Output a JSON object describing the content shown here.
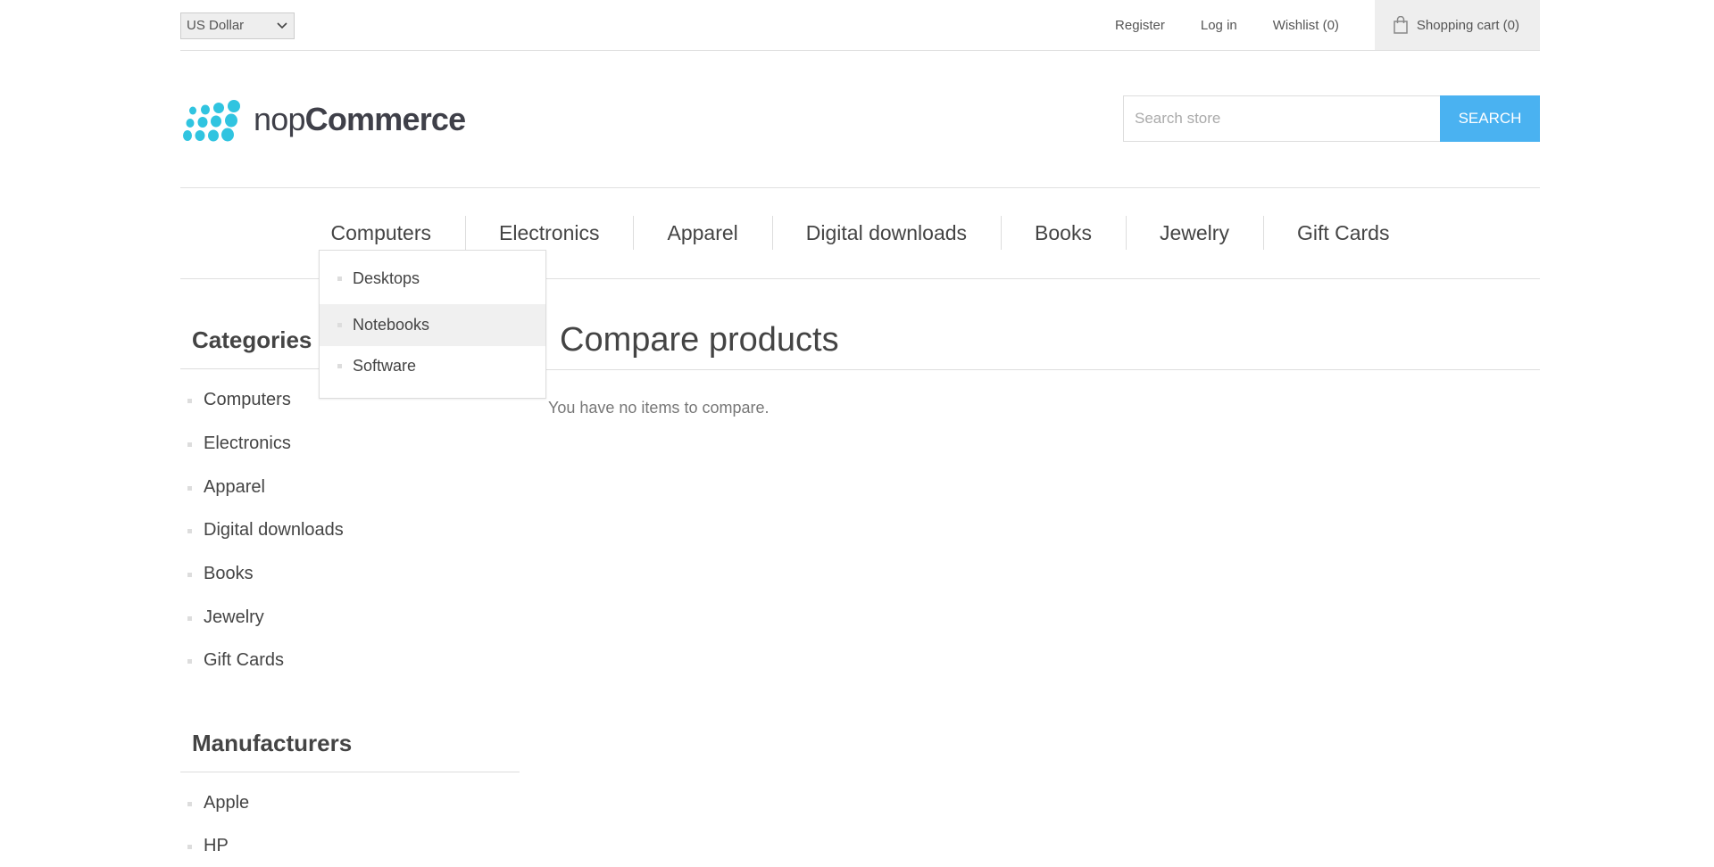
{
  "header": {
    "currency": "US Dollar",
    "links": [
      "Register",
      "Log in",
      "Wishlist (0)"
    ],
    "cart": "Shopping cart (0)"
  },
  "logo": {
    "part1": "nop",
    "part2": "Commerce"
  },
  "search": {
    "placeholder": "Search store",
    "button": "SEARCH"
  },
  "top_menu": [
    "Computers",
    "Electronics",
    "Apparel",
    "Digital downloads",
    "Books",
    "Jewelry",
    "Gift Cards"
  ],
  "dropdown": [
    "Desktops",
    "Notebooks",
    "Software"
  ],
  "sidebar": {
    "categories_title": "Categories",
    "categories": [
      "Computers",
      "Electronics",
      "Apparel",
      "Digital downloads",
      "Books",
      "Jewelry",
      "Gift Cards"
    ],
    "manufacturers_title": "Manufacturers",
    "manufacturers": [
      "Apple",
      "HP"
    ]
  },
  "main": {
    "title": "Compare products",
    "empty_message": "You have no items to compare."
  },
  "colors": {
    "accent": "#4ab2f1",
    "logo_dots": "#30c4e0"
  }
}
